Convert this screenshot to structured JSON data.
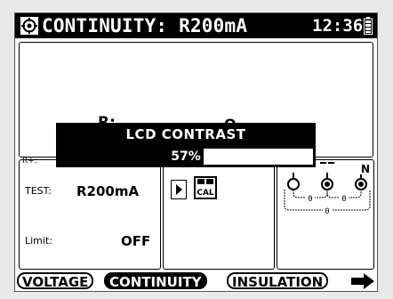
{
  "header": {
    "title": "CONTINUITY: R200mA",
    "time": "12:36",
    "icons": [
      "mode-icon",
      "battery-icon"
    ]
  },
  "result": {
    "r_label": "R:",
    "unit": "Ω",
    "rplus_label": "R+:"
  },
  "params": {
    "test_label": "TEST:",
    "test_value": "R200mA",
    "limit_label": "Limit:",
    "limit_value": "OFF"
  },
  "controls": {
    "cal_label": "CAL",
    "icons": [
      "play-icon",
      "cal-icon"
    ]
  },
  "terminals": {
    "labels": [
      "N"
    ],
    "readings": [
      "0",
      "0",
      "0"
    ]
  },
  "tabs": [
    {
      "label": "VOLTAGE",
      "active": false
    },
    {
      "label": "CONTINUITY",
      "active": true
    },
    {
      "label": "INSULATION",
      "active": false
    }
  ],
  "popup": {
    "title": "LCD CONTRAST",
    "value_text": "57%",
    "level": 0.57
  },
  "colors": {
    "foreground": "#000000",
    "background": "#ffffff"
  }
}
